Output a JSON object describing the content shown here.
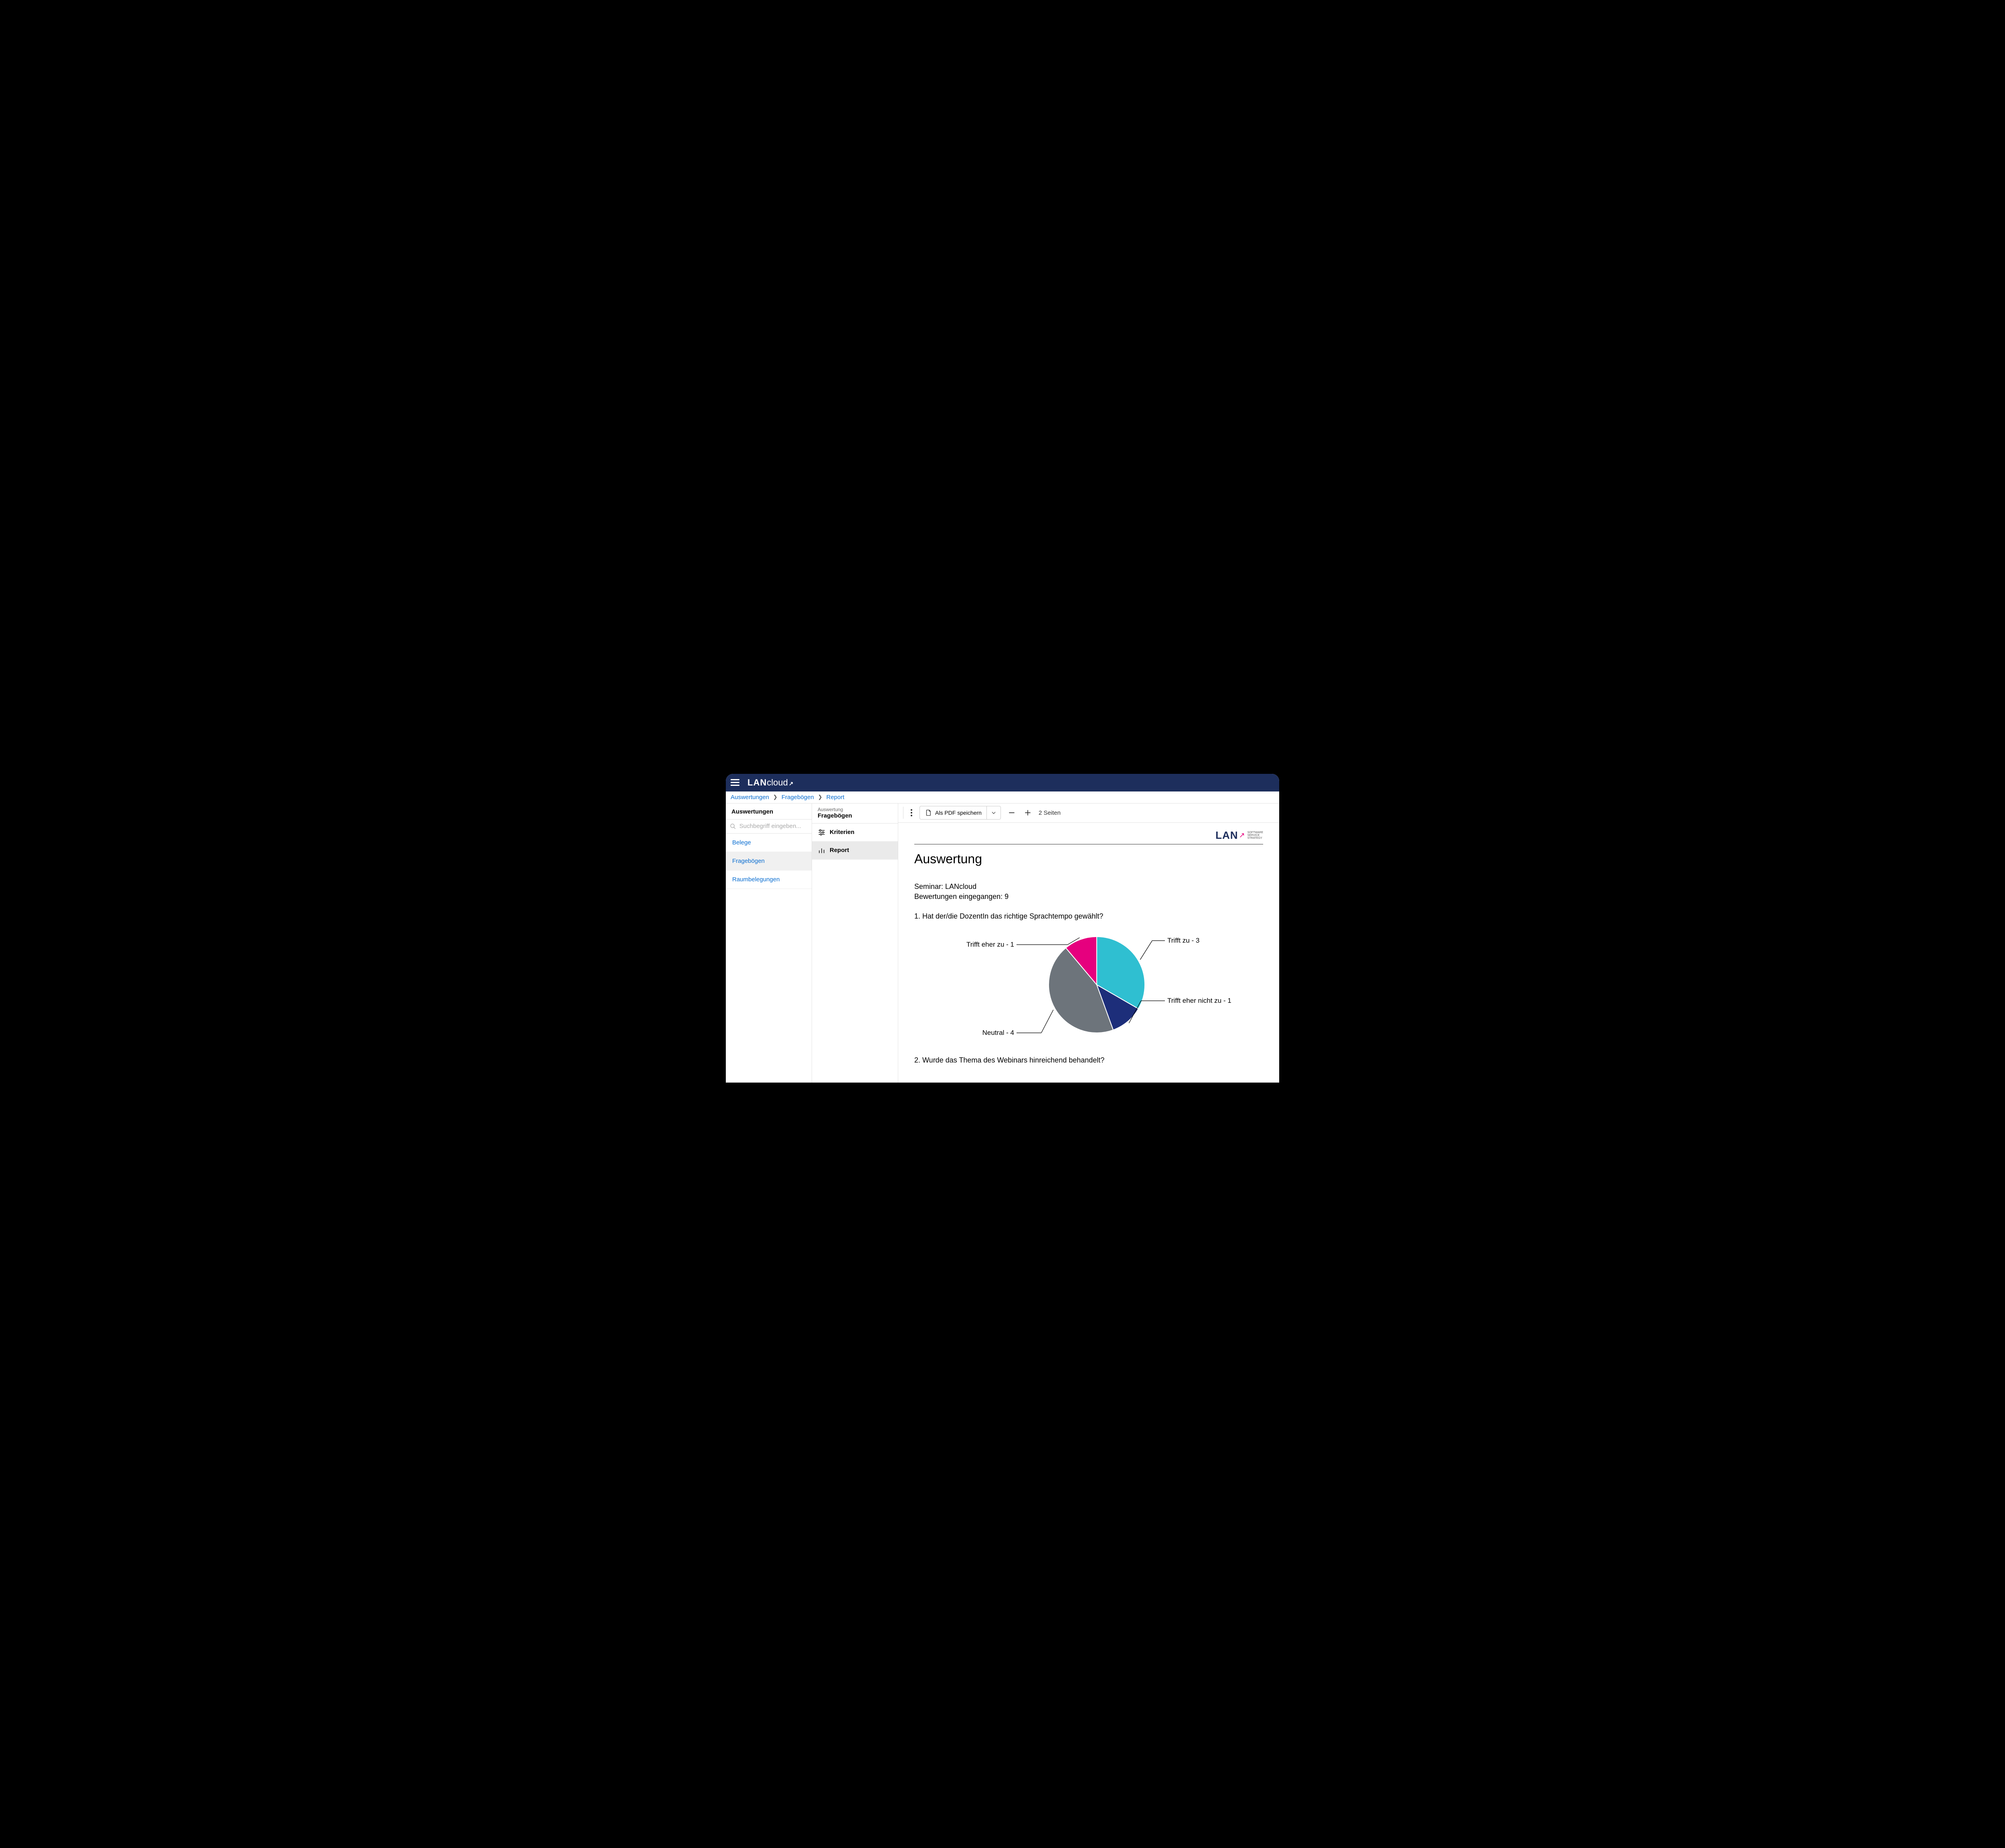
{
  "header": {
    "brand_bold": "LAN",
    "brand_thin": "cloud",
    "brand_arrow": "↗"
  },
  "breadcrumb": [
    "Auswertungen",
    "Fragebögen",
    "Report"
  ],
  "sidebar_left": {
    "title": "Auswertungen",
    "search_placeholder": "Suchbegriff eingeben...",
    "items": [
      "Belege",
      "Fragebögen",
      "Raumbelegungen"
    ],
    "active_index": 1
  },
  "sidebar_mid": {
    "small": "Auswertung",
    "big": "Fragebögen",
    "items": [
      "Kriterien",
      "Report"
    ],
    "active_index": 1
  },
  "toolbar": {
    "pdf_label": "Als PDF speichern",
    "page_count": "2 Seiten"
  },
  "report": {
    "logo": {
      "text": "LAN",
      "arrow": "↗",
      "sub1": "SOFTWARE",
      "sub2": "SERVICE",
      "sub3": "STRATEGY"
    },
    "title": "Auswertung",
    "seminar_line": "Seminar: LANcloud",
    "ratings_line": "Bewertungen eingegangen: 9",
    "q1": "1. Hat der/die DozentIn das richtige Sprachtempo gewählt?",
    "q2": "2. Wurde das Thema des Webinars hinreichend behandelt?"
  },
  "chart_data": {
    "type": "pie",
    "title": "",
    "total": 9,
    "series": [
      {
        "name": "Trifft zu",
        "value": 3,
        "color": "#2fbfd1",
        "label": "Trifft zu - 3"
      },
      {
        "name": "Trifft eher nicht zu",
        "value": 1,
        "color": "#1d2e7a",
        "label": "Trifft eher nicht zu - 1"
      },
      {
        "name": "Neutral",
        "value": 4,
        "color": "#6d747b",
        "label": "Neutral - 4"
      },
      {
        "name": "Trifft eher zu",
        "value": 1,
        "color": "#e6007e",
        "label": "Trifft eher zu - 1"
      }
    ]
  }
}
